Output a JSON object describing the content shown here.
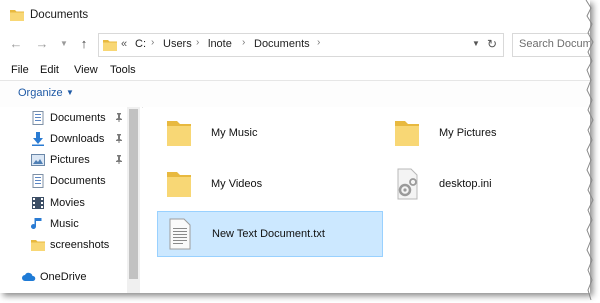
{
  "window": {
    "title": "Documents"
  },
  "address": {
    "crumbs": [
      "C:",
      "Users",
      "lnote",
      "Documents"
    ],
    "overflow": "«"
  },
  "search": {
    "placeholder": "Search Documents"
  },
  "menu": {
    "items": [
      "File",
      "Edit",
      "View",
      "Tools"
    ]
  },
  "toolbar": {
    "organize": "Organize"
  },
  "sidebar": {
    "items": [
      {
        "label": "Documents",
        "icon": "documents-icon",
        "pinned": true
      },
      {
        "label": "Downloads",
        "icon": "downloads-icon",
        "pinned": true
      },
      {
        "label": "Pictures",
        "icon": "pictures-icon",
        "pinned": true
      },
      {
        "label": "Documents",
        "icon": "documents-icon",
        "pinned": false
      },
      {
        "label": "Movies",
        "icon": "movies-icon",
        "pinned": false
      },
      {
        "label": "Music",
        "icon": "music-icon",
        "pinned": false
      },
      {
        "label": "screenshots",
        "icon": "folder-icon",
        "pinned": false
      },
      {
        "label": "OneDrive",
        "icon": "onedrive-icon",
        "pinned": false
      }
    ]
  },
  "files": [
    {
      "name": "My Music",
      "icon": "folder-icon",
      "selected": false
    },
    {
      "name": "My Pictures",
      "icon": "folder-icon",
      "selected": false
    },
    {
      "name": "My Videos",
      "icon": "folder-icon",
      "selected": false
    },
    {
      "name": "desktop.ini",
      "icon": "settings-file-icon",
      "selected": false
    },
    {
      "name": "New Text Document.txt",
      "icon": "text-file-icon",
      "selected": true
    }
  ],
  "colors": {
    "selection": "#cce8ff",
    "selection_border": "#99d1ff",
    "folder": "#f8d775",
    "link": "#1f5aa6"
  }
}
